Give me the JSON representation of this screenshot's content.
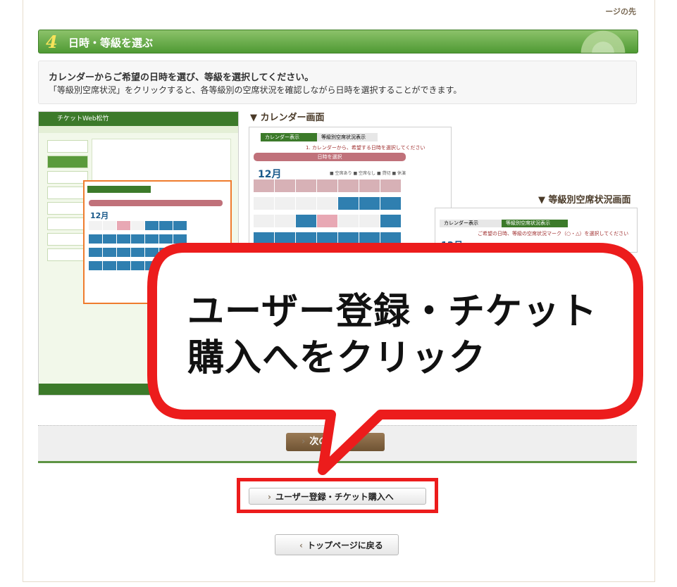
{
  "top_link": "ージの先",
  "section": {
    "number": "4",
    "title": "日時・等級を選ぶ"
  },
  "description": {
    "line1": "カレンダーからご希望の日時を選び、等級を選択してください。",
    "line2": "「等級別空席状況」をクリックすると、各等級別の空席状況を確認しながら日時を選択することができます。"
  },
  "screens": {
    "left_header": "チケットWeb松竹",
    "calendar_label": "▼ カレンダー画面",
    "grade_label": "▼ 等級別空席状況画面",
    "calendar": {
      "tab_calendar": "カレンダー表示",
      "tab_grade": "等級別空席状況表示",
      "note": "1. カレンダーから、希望する日時を選択してください",
      "bar": "日時を選択",
      "month": "12月",
      "legend": "■ 空席あり ■ 空席なし ■ 貸切 ■ 休演"
    },
    "grade": {
      "tab_calendar": "カレンダー表示",
      "tab_grade": "等級別空席状況表示",
      "note": "ご希望の日時、等級の空席状況マーク（○・△）を選択してください",
      "month": "12月"
    },
    "mini_month": "12月"
  },
  "callout": {
    "line1": "ユーザー登録・チケット",
    "line2": "購入へをクリック"
  },
  "buttons": {
    "next": "次のステ",
    "user_register": "ユーザー登録・チケット購入へ",
    "top_page": "トップページに戻る"
  },
  "colors": {
    "green": "#5e9444",
    "callout_red": "#ec1c1c",
    "orange": "#ef7c2e"
  }
}
